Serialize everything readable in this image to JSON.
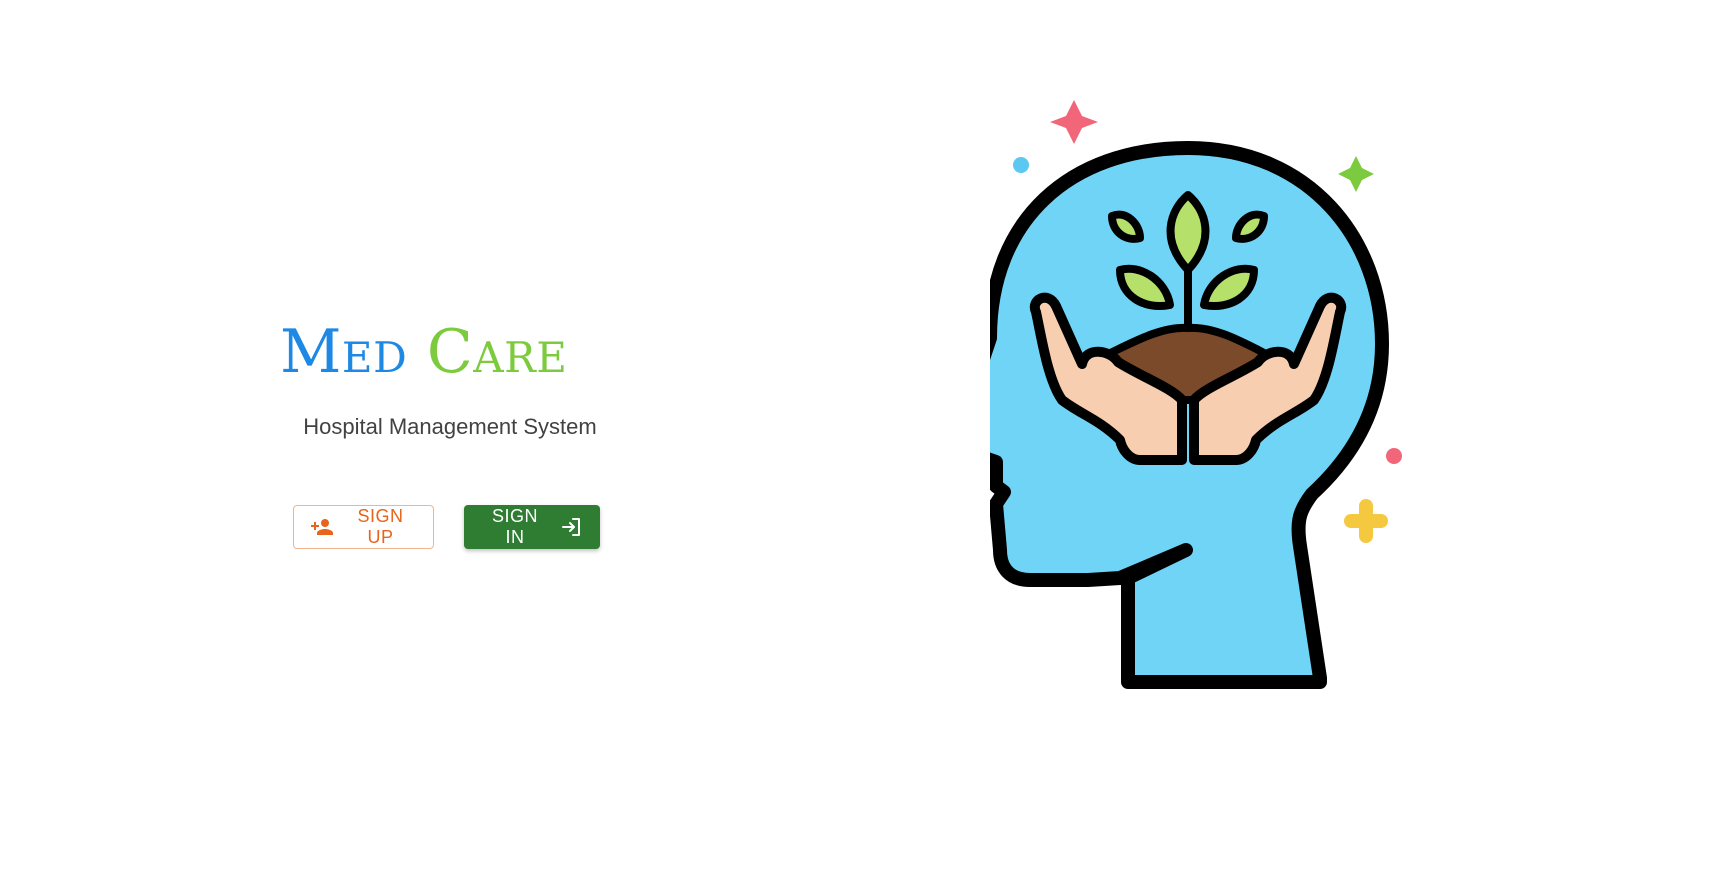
{
  "brand": {
    "name_part1": "Med",
    "name_part2": "Care",
    "subtitle": "Hospital Management System"
  },
  "actions": {
    "signup": {
      "label": "SIGN UP",
      "icon": "person-add-icon"
    },
    "signin": {
      "label": "SIGN IN",
      "icon": "login-icon"
    }
  },
  "illustration": {
    "icon": "mental-health-head-icon",
    "colors": {
      "head": "#70d4f7",
      "outline": "#000000",
      "leaf": "#b5e06a",
      "soil": "#7a4a2a",
      "hands": "#f7cfb0",
      "sparkle_red": "#f2667a",
      "sparkle_green": "#7ccb3e",
      "dot_blue": "#5bc8f2",
      "plus_yellow": "#f5c93f"
    }
  },
  "colors": {
    "brand_blue": "#1e88e5",
    "brand_green": "#7ccb3e",
    "signup_orange": "#e8641b",
    "signin_green": "#2e7d32"
  }
}
